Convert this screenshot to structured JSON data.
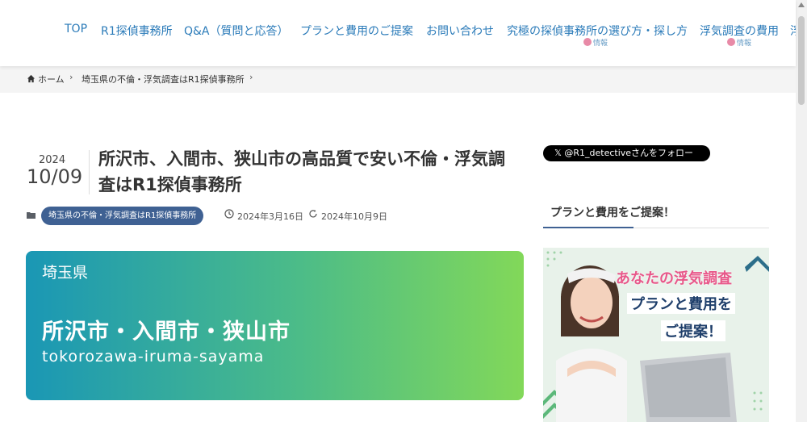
{
  "nav": {
    "items": [
      {
        "label": "TOP"
      },
      {
        "label": "R1探偵事務所"
      },
      {
        "label": "Q&A（質問と応答）"
      },
      {
        "label": "プランと費用のご提案"
      },
      {
        "label": "お問い合わせ"
      },
      {
        "label": "究極の探偵事務所の選び方・探し方",
        "sub": "情報"
      },
      {
        "label": "浮気調査の費用",
        "sub": "情報"
      },
      {
        "label": "浮"
      }
    ]
  },
  "breadcrumb": {
    "home": "ホーム",
    "category": "埼玉県の不倫・浮気調査はR1探偵事務所"
  },
  "article": {
    "year": "2024",
    "day": "10/09",
    "title": "所沢市、入間市、狭山市の高品質で安い不倫・浮気調査はR1探偵事務所",
    "category": "埼玉県の不倫・浮気調査はR1探偵事務所",
    "published": "2024年3月16日",
    "updated": "2024年10月9日"
  },
  "hero": {
    "prefecture": "埼玉県",
    "cities": "所沢市・入間市・狭山市",
    "roman": "tokorozawa-iruma-sayama"
  },
  "sidebar": {
    "follow_label": "𝕏 @R1_detectiveさんをフォロー",
    "heading": "プランと費用をご提案！",
    "ad": {
      "line1": "あなたの浮気調査",
      "line2": "プランと費用を",
      "line3": "ご提案！"
    }
  },
  "colors": {
    "nav_link": "#2b7bb9",
    "category_pill": "#3f6193",
    "hero_gradient_start": "#1a97b5",
    "hero_gradient_end": "#82d859"
  }
}
